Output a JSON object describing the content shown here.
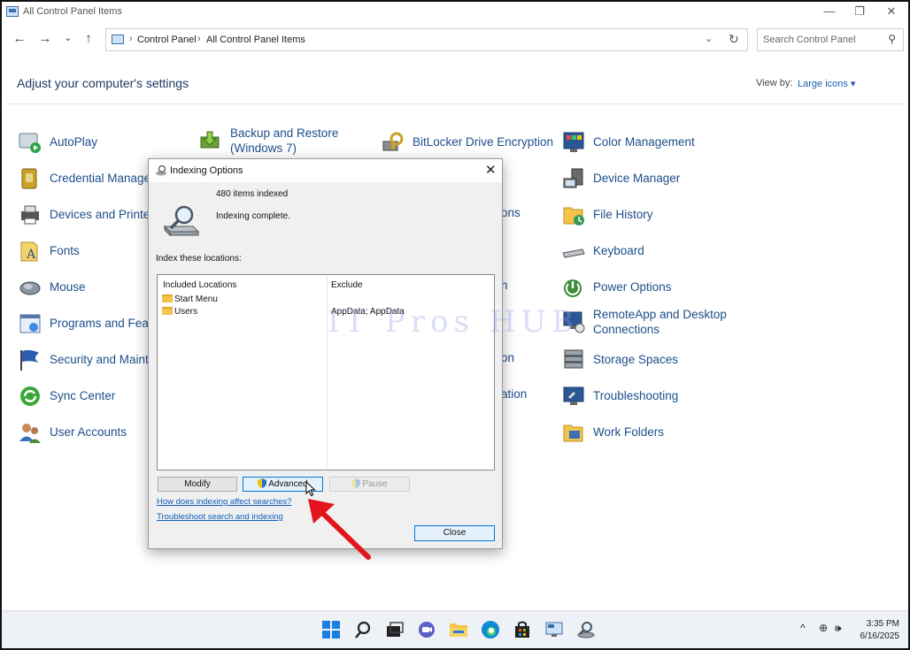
{
  "window": {
    "title": "All Control Panel Items",
    "minimize_glyph": "—",
    "restore_glyph": "❐",
    "close_glyph": "✕"
  },
  "nav": {
    "back_glyph": "←",
    "forward_glyph": "→",
    "recent_glyph": "⌄",
    "up_glyph": "↑"
  },
  "address": {
    "crumbs": [
      "Control Panel",
      "All Control Panel Items"
    ],
    "separator": "›",
    "dropdown_glyph": "⌄",
    "refresh_glyph": "↻"
  },
  "search": {
    "placeholder": "Search Control Panel",
    "icon_glyph": "⚲"
  },
  "header": {
    "title": "Adjust your computer's settings",
    "view_by_label": "View by:",
    "view_by_value": "Large icons ▾"
  },
  "items": {
    "col1": [
      "AutoPlay",
      "Credential Manager",
      "Devices and Printers",
      "Fonts",
      "Mouse",
      "Programs and Features",
      "Security and Maintenance",
      "Sync Center",
      "User Accounts"
    ],
    "col2": [
      "Backup and Restore (Windows 7)"
    ],
    "col2_line1": "Backup and Restore",
    "col2_line2": "(Windows 7)",
    "col3": [
      "BitLocker Drive Encryption",
      "ons",
      "n",
      "on",
      "ation"
    ],
    "col4": [
      "Color Management",
      "Device Manager",
      "File History",
      "Keyboard",
      "Power Options",
      "RemoteApp and Desktop Connections",
      "Storage Spaces",
      "Troubleshooting",
      "Work Folders"
    ],
    "col4_remote_line1": "RemoteApp and Desktop",
    "col4_remote_line2": "Connections"
  },
  "watermark": "IT Pros HUB",
  "dialog": {
    "title": "Indexing Options",
    "close_glyph": "✕",
    "items_indexed": "480 items indexed",
    "status": "Indexing complete.",
    "locations_label": "Index these locations:",
    "col_included": "Included Locations",
    "col_exclude": "Exclude",
    "locations": [
      {
        "name": "Start Menu",
        "exclude": ""
      },
      {
        "name": "Users",
        "exclude": "AppData; AppData"
      }
    ],
    "buttons": {
      "modify": "Modify",
      "advanced": "Advanced",
      "pause": "Pause",
      "close": "Close"
    },
    "links": [
      "How does indexing affect searches?",
      "Troubleshoot search and indexing"
    ],
    "grip_glyph": "⋰"
  },
  "taskbar": {
    "time": "3:35 PM",
    "date": "6/16/2025",
    "tray_chevron": "^",
    "tray_network": "⊕",
    "tray_volume": "🕪"
  },
  "colors": {
    "link": "#1c4e8a",
    "accent": "#0078d7",
    "annotation_arrow": "#e3141b"
  }
}
